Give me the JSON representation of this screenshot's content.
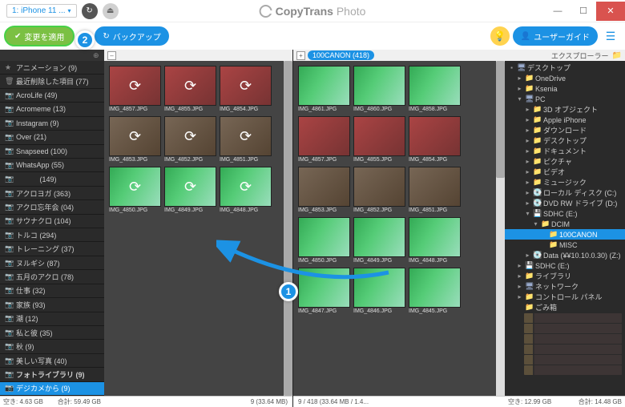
{
  "titlebar": {
    "device": "1: iPhone 11 ...",
    "app_name_bold": "CopyTrans",
    "app_name_thin": "Photo"
  },
  "toolbar": {
    "apply_label": "変更を適用",
    "backup_label": "バックアップ",
    "userguide_label": "ユーザーガイド"
  },
  "callouts": {
    "one": "1",
    "two": "2"
  },
  "sidebar": {
    "items": [
      {
        "icon": "★",
        "label": "アニメーション (9)"
      },
      {
        "icon": "🗑",
        "label": "最近削除した項目 (77)"
      },
      {
        "icon": "📷",
        "label": "AcroLife (49)"
      },
      {
        "icon": "📷",
        "label": "Acromeme (13)"
      },
      {
        "icon": "📷",
        "label": "Instagram (9)"
      },
      {
        "icon": "📷",
        "label": "Over (21)"
      },
      {
        "icon": "📷",
        "label": "Snapseed (100)"
      },
      {
        "icon": "📷",
        "label": "WhatsApp (55)"
      },
      {
        "icon": "📷",
        "label": "　　　 (149)"
      },
      {
        "icon": "📷",
        "label": "アクロヨガ (363)"
      },
      {
        "icon": "📷",
        "label": "アクロ忘年会 (04)"
      },
      {
        "icon": "📷",
        "label": "サウナクロ (104)"
      },
      {
        "icon": "📷",
        "label": "トルコ (294)"
      },
      {
        "icon": "📷",
        "label": "トレーニング (37)"
      },
      {
        "icon": "📷",
        "label": "ヌルギシ (87)"
      },
      {
        "icon": "📷",
        "label": "五月のアクロ (78)"
      },
      {
        "icon": "📷",
        "label": "仕事 (32)"
      },
      {
        "icon": "📷",
        "label": "家族 (93)"
      },
      {
        "icon": "📷",
        "label": "潮 (12)"
      },
      {
        "icon": "📷",
        "label": "私と彼 (35)"
      },
      {
        "icon": "📷",
        "label": "秋 (9)"
      },
      {
        "icon": "📷",
        "label": "美しい写真 (40)"
      },
      {
        "icon": "📷",
        "label": "フォトライブラリ (9)",
        "bold": true
      },
      {
        "icon": "📷",
        "label": "デジカメから (9)",
        "selected": true
      }
    ],
    "footer_left": "空き: 4.63 GB",
    "footer_right": "合計: 59.49 GB"
  },
  "left_pane": {
    "thumbs": [
      {
        "name": "IMG_4857.JPG",
        "v": "red",
        "sync": true
      },
      {
        "name": "IMG_4855.JPG",
        "v": "red",
        "sync": true
      },
      {
        "name": "IMG_4854.JPG",
        "v": "red",
        "sync": true
      },
      {
        "name": "IMG_4853.JPG",
        "v": "ppl",
        "sync": true
      },
      {
        "name": "IMG_4852.JPG",
        "v": "ppl",
        "sync": true
      },
      {
        "name": "IMG_4851.JPG",
        "v": "ppl",
        "sync": true
      },
      {
        "name": "IMG_4850.JPG",
        "v": "trees",
        "sync": true
      },
      {
        "name": "IMG_4849.JPG",
        "v": "trees",
        "sync": true
      },
      {
        "name": "IMG_4848.JPG",
        "v": "trees",
        "sync": true
      }
    ],
    "footer": "9 (33.64 MB)"
  },
  "right_pane": {
    "breadcrumb": "100CANON (418)",
    "thumbs": [
      {
        "name": "IMG_4861.JPG",
        "v": "trees"
      },
      {
        "name": "IMG_4860.JPG",
        "v": "trees"
      },
      {
        "name": "IMG_4858.JPG",
        "v": "trees"
      },
      {
        "name": "IMG_4857.JPG",
        "v": "red"
      },
      {
        "name": "IMG_4855.JPG",
        "v": "red"
      },
      {
        "name": "IMG_4854.JPG",
        "v": "red"
      },
      {
        "name": "IMG_4853.JPG",
        "v": "ppl"
      },
      {
        "name": "IMG_4852.JPG",
        "v": "ppl"
      },
      {
        "name": "IMG_4851.JPG",
        "v": "ppl"
      },
      {
        "name": "IMG_4850.JPG",
        "v": "trees"
      },
      {
        "name": "IMG_4849.JPG",
        "v": "trees"
      },
      {
        "name": "IMG_4848.JPG",
        "v": "trees"
      },
      {
        "name": "IMG_4847.JPG",
        "v": "trees"
      },
      {
        "name": "IMG_4846.JPG",
        "v": "trees"
      },
      {
        "name": "IMG_4845.JPG",
        "v": "trees"
      }
    ],
    "footer": "9 / 418 (33.64 MB / 1.4..."
  },
  "explorer": {
    "header": "エクスプローラー",
    "tree": [
      {
        "ind": 0,
        "exp": "▪",
        "fic": "pc",
        "label": "デスクトップ"
      },
      {
        "ind": 1,
        "exp": "▸",
        "fic": "folder",
        "label": "OneDrive"
      },
      {
        "ind": 1,
        "exp": "▸",
        "fic": "folder",
        "label": "Ksenia"
      },
      {
        "ind": 1,
        "exp": "▾",
        "fic": "pc",
        "label": "PC"
      },
      {
        "ind": 2,
        "exp": "▸",
        "fic": "folder",
        "label": "3D オブジェクト"
      },
      {
        "ind": 2,
        "exp": "▸",
        "fic": "folder",
        "label": "Apple iPhone"
      },
      {
        "ind": 2,
        "exp": "▸",
        "fic": "folder",
        "label": "ダウンロード"
      },
      {
        "ind": 2,
        "exp": "▸",
        "fic": "folder",
        "label": "デスクトップ"
      },
      {
        "ind": 2,
        "exp": "▸",
        "fic": "folder",
        "label": "ドキュメント"
      },
      {
        "ind": 2,
        "exp": "▸",
        "fic": "folder",
        "label": "ピクチャ"
      },
      {
        "ind": 2,
        "exp": "▸",
        "fic": "folder",
        "label": "ビデオ"
      },
      {
        "ind": 2,
        "exp": "▸",
        "fic": "folder",
        "label": "ミュージック"
      },
      {
        "ind": 2,
        "exp": "▸",
        "fic": "drive",
        "label": "ローカル ディスク (C:)"
      },
      {
        "ind": 2,
        "exp": "▸",
        "fic": "drive",
        "label": "DVD RW ドライブ (D:)"
      },
      {
        "ind": 2,
        "exp": "▾",
        "fic": "sd",
        "label": "SDHC (E:)"
      },
      {
        "ind": 3,
        "exp": "▾",
        "fic": "folder",
        "label": "DCIM"
      },
      {
        "ind": 4,
        "exp": "",
        "fic": "folder",
        "label": "100CANON",
        "selected": true
      },
      {
        "ind": 4,
        "exp": "",
        "fic": "folder",
        "label": "MISC"
      },
      {
        "ind": 2,
        "exp": "▸",
        "fic": "drive",
        "label": "Data (¥¥10.10.0.30) (Z:)"
      },
      {
        "ind": 1,
        "exp": "▸",
        "fic": "sd",
        "label": "SDHC (E:)"
      },
      {
        "ind": 1,
        "exp": "▸",
        "fic": "folder",
        "label": "ライブラリ"
      },
      {
        "ind": 1,
        "exp": "▸",
        "fic": "pc",
        "label": "ネットワーク"
      },
      {
        "ind": 1,
        "exp": "▸",
        "fic": "folder",
        "label": "コントロール パネル"
      },
      {
        "ind": 1,
        "exp": "",
        "fic": "folder",
        "label": "ごみ箱"
      }
    ],
    "footer_left": "空き: 12.99 GB",
    "footer_right": "合計: 14.48 GB"
  }
}
